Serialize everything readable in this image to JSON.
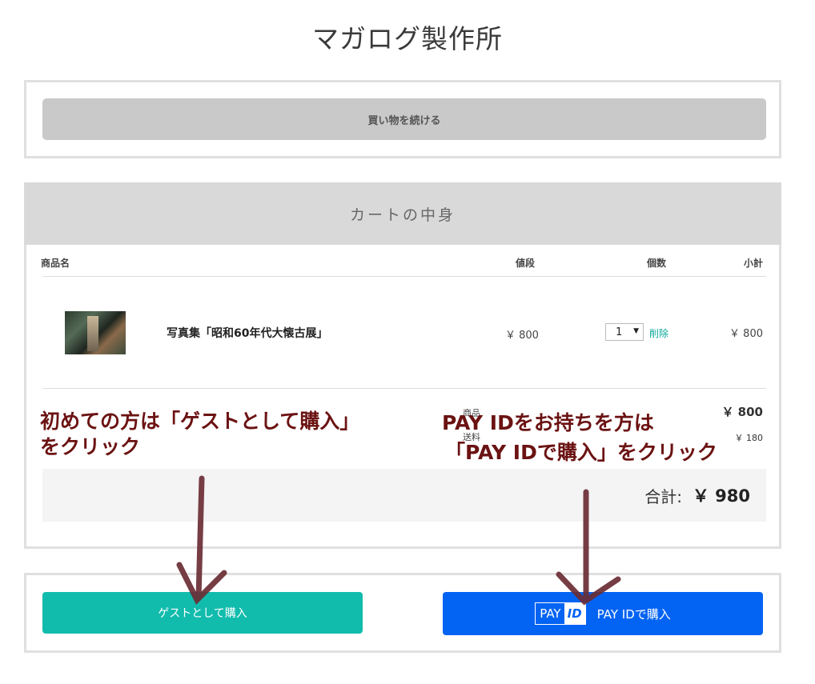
{
  "shop": {
    "title": "マガログ製作所"
  },
  "continue_button": {
    "label": "買い物を続ける"
  },
  "cart": {
    "heading": "カートの中身",
    "columns": {
      "name": "商品名",
      "price": "値段",
      "qty": "個数",
      "subtotal": "小計"
    },
    "item": {
      "thumbnail_icon": "photo-thumbnail",
      "name": "写真集「昭和60年代大懐古展」",
      "price": "￥ 800",
      "qty": "1",
      "delete_label": "削除",
      "subtotal": "￥ 800"
    },
    "summary": {
      "items_label": "商品",
      "items_value": "￥ 800",
      "shipping_label": "送料",
      "shipping_value": "￥ 180",
      "total_label": "合計:",
      "total_value": "￥ 980"
    }
  },
  "buttons": {
    "guest": "ゲストとして購入",
    "payid_logo_pay": "PAY",
    "payid_logo_id": "ID",
    "payid": "PAY IDで購入"
  },
  "annotations": {
    "left_line1": "初めての方は「ゲストとして購入」",
    "left_line2": "をクリック",
    "right_line1": "PAY IDをお持ちを方は",
    "right_line2": "「PAY IDで購入」をクリック",
    "color": "#6b1212"
  },
  "colors": {
    "guest_button": "#12bcad",
    "payid_button": "#0363f3",
    "delete_link": "#0aa89a",
    "arrow": "#6a2c34"
  }
}
